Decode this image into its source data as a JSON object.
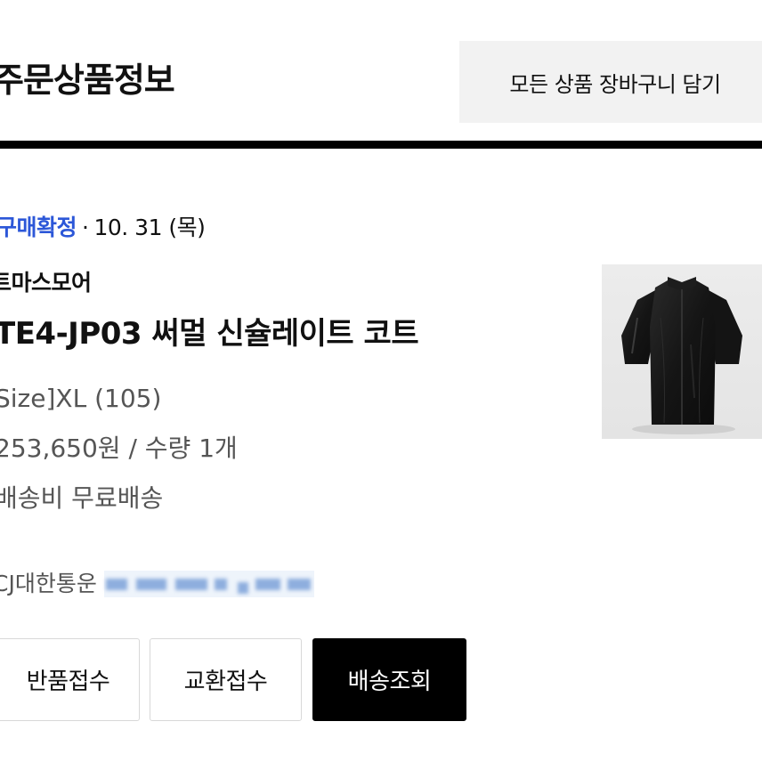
{
  "header": {
    "title": "주문상품정보",
    "cart_all_label": "모든 상품 장바구니 담기"
  },
  "order": {
    "status_label": "구매확정",
    "separator": "·",
    "date": "10. 31 (목)",
    "store_name": "트마스모어",
    "product_name": "TE4-JP03 써멀 신슐레이트 코트",
    "option": "Size]XL (105)",
    "price_qty": "253,650원 / 수량 1개",
    "shipping": "배송비 무료배송",
    "courier": "CJ대한통운",
    "thumbnail_icon": "jacket-photo"
  },
  "actions": {
    "return_label": "반품접수",
    "exchange_label": "교환접수",
    "tracking_label": "배송조회"
  },
  "colors": {
    "status": "#2c57d8",
    "primary_button": "#000000",
    "secondary_bg": "#f2f2f2"
  }
}
